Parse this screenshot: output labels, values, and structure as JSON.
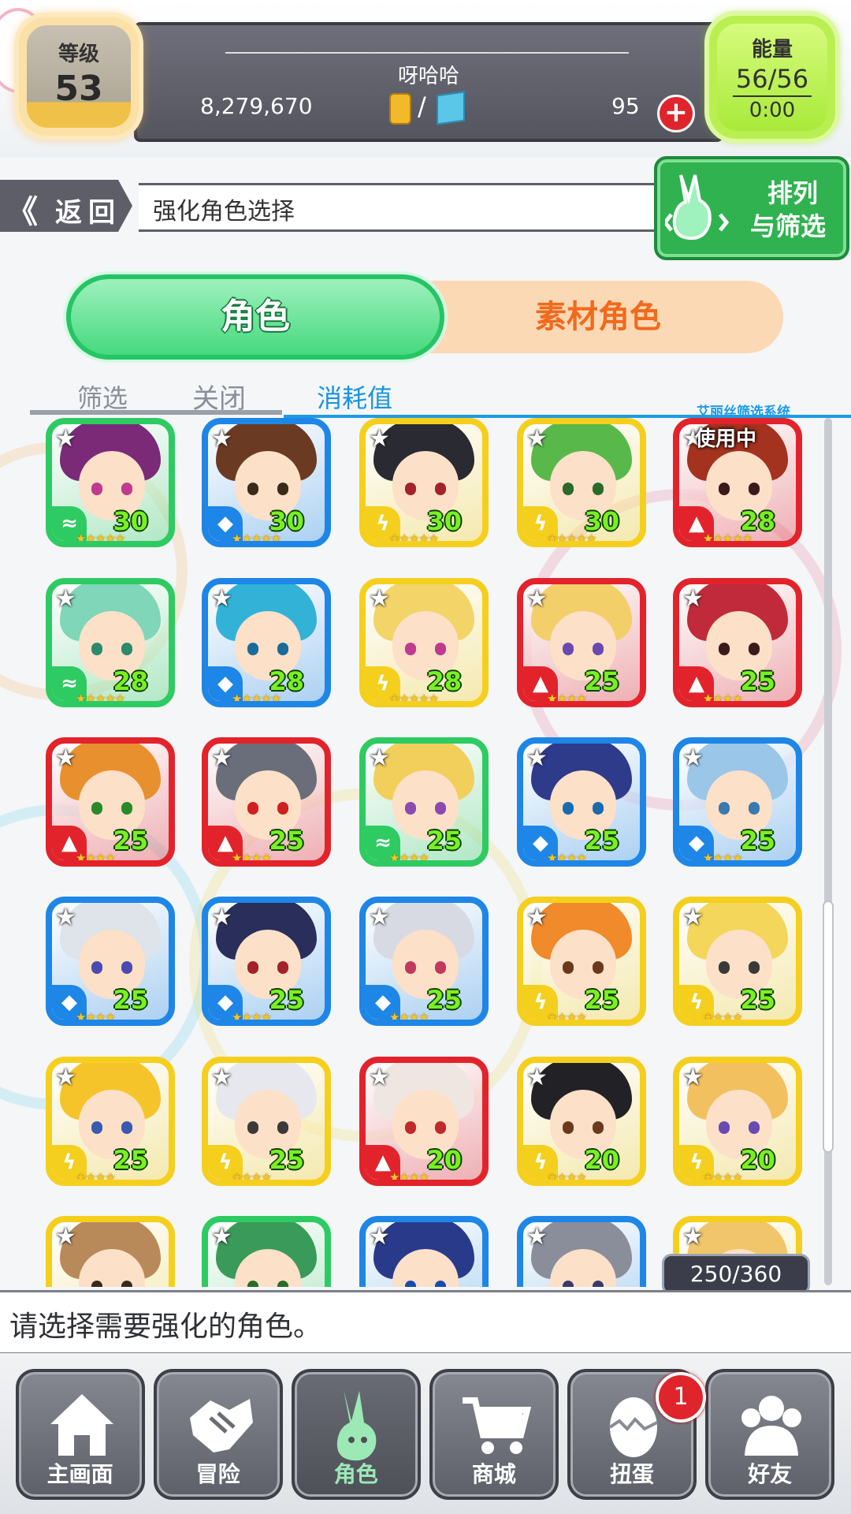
{
  "header": {
    "level_label": "等级",
    "level_value": "53",
    "player_name": "呀哈哈",
    "coins": "8,279,670",
    "currency_separator": "/",
    "gems": "95",
    "add_gems_symbol": "+",
    "energy_label": "能量",
    "energy_value": "56/56",
    "energy_timer": "0:00"
  },
  "nav": {
    "menu_symbol": "›",
    "back_chevron": "《",
    "back_label": "返回",
    "screen_title": "强化角色选择",
    "sort_line1": "排列",
    "sort_line2": "与筛选"
  },
  "tabs": {
    "character": "角色",
    "material": "素材角色"
  },
  "filter": {
    "label": "筛选",
    "status": "关闭",
    "sort_basis": "消耗值",
    "system_label": "艾丽丝筛选系统"
  },
  "colors": {
    "wood": "#2ecb62",
    "water": "#1e86e6",
    "thunder": "#f5cf1d",
    "fire": "#e3232b"
  },
  "grid": {
    "in_use_label": "使用中",
    "count": "250/360",
    "cards": [
      {
        "element": "wood",
        "level": "30",
        "stars": "★★★★★",
        "hair": "#7b2a78",
        "eye": "#c03a8f"
      },
      {
        "element": "water",
        "level": "30",
        "stars": "★★★★★",
        "hair": "#6b3a22",
        "eye": "#3a2a1a"
      },
      {
        "element": "thunder",
        "level": "30",
        "stars": "★★★★★",
        "hair": "#2a2a33",
        "eye": "#a3232a"
      },
      {
        "element": "thunder",
        "level": "30",
        "stars": "★★★★★",
        "hair": "#59b84a",
        "eye": "#2a6a2a"
      },
      {
        "element": "fire",
        "level": "28",
        "stars": "★★★★★",
        "hair": "#a3321e",
        "eye": "#3a1a1a",
        "in_use": true
      },
      {
        "element": "wood",
        "level": "28",
        "stars": "★★★★★",
        "hair": "#7fd6b8",
        "eye": "#2c8a6c"
      },
      {
        "element": "water",
        "level": "28",
        "stars": "★★★★★",
        "hair": "#33b2d8",
        "eye": "#1a6a9a"
      },
      {
        "element": "thunder",
        "level": "28",
        "stars": "★★★★★",
        "hair": "#f2d469",
        "eye": "#c03a8f"
      },
      {
        "element": "fire",
        "level": "25",
        "stars": "★★★★",
        "hair": "#f3cf6a",
        "eye": "#6a4ab0"
      },
      {
        "element": "fire",
        "level": "25",
        "stars": "★★★★",
        "hair": "#c02a3a",
        "eye": "#3a1a1a"
      },
      {
        "element": "fire",
        "level": "25",
        "stars": "★★★★",
        "hair": "#e8902e",
        "eye": "#2a8a2a"
      },
      {
        "element": "fire",
        "level": "25",
        "stars": "★★★★",
        "hair": "#6a6e7a",
        "eye": "#d02020"
      },
      {
        "element": "wood",
        "level": "25",
        "stars": "★★★★",
        "hair": "#f1cf5a",
        "eye": "#8a4ab0"
      },
      {
        "element": "water",
        "level": "25",
        "stars": "★★★★",
        "hair": "#2e3a8a",
        "eye": "#1a6ab0"
      },
      {
        "element": "water",
        "level": "25",
        "stars": "★★★★",
        "hair": "#9ac6e8",
        "eye": "#3a7ab0"
      },
      {
        "element": "water",
        "level": "25",
        "stars": "★★★★",
        "hair": "#dfe3ea",
        "eye": "#4a4ab0"
      },
      {
        "element": "water",
        "level": "25",
        "stars": "★★★★",
        "hair": "#2a2e5a",
        "eye": "#a3232a"
      },
      {
        "element": "water",
        "level": "25",
        "stars": "★★★★",
        "hair": "#d8dae3",
        "eye": "#c03a5f"
      },
      {
        "element": "thunder",
        "level": "25",
        "stars": "★★★★",
        "hair": "#f08a2a",
        "eye": "#6a3a1a"
      },
      {
        "element": "thunder",
        "level": "25",
        "stars": "★★★★",
        "hair": "#f3d65a",
        "eye": "#3a3a3a"
      },
      {
        "element": "thunder",
        "level": "25",
        "stars": "★★★★",
        "hair": "#f5c42a",
        "eye": "#3a5ab0"
      },
      {
        "element": "thunder",
        "level": "25",
        "stars": "★★★★",
        "hair": "#e6e8ee",
        "eye": "#3a3a3a"
      },
      {
        "element": "fire",
        "level": "20",
        "stars": "★★★★",
        "hair": "#efe6e2",
        "eye": "#c02a2a"
      },
      {
        "element": "thunder",
        "level": "20",
        "stars": "★★★★",
        "hair": "#222226",
        "eye": "#6a3a1a"
      },
      {
        "element": "thunder",
        "level": "20",
        "stars": "★★★★",
        "hair": "#f3c060",
        "eye": "#6a4ab0"
      },
      {
        "element": "thunder",
        "level": "",
        "stars": "",
        "hair": "#b88a5a",
        "eye": "#3a2a1a"
      },
      {
        "element": "wood",
        "level": "",
        "stars": "",
        "hair": "#3a9a5a",
        "eye": "#2a6a2a"
      },
      {
        "element": "water",
        "level": "",
        "stars": "",
        "hair": "#2a3a8a",
        "eye": "#1a4ab0"
      },
      {
        "element": "water",
        "level": "",
        "stars": "",
        "hair": "#8a8e9a",
        "eye": "#3a3a6a"
      },
      {
        "element": "thunder",
        "level": "",
        "stars": "",
        "hair": "#f1c66a",
        "eye": "#6a3a1a"
      }
    ]
  },
  "instruction": "请选择需要强化的角色。",
  "bottom_nav": {
    "gacha_badge": "1",
    "items": [
      {
        "label": "主画面",
        "icon": "home-icon"
      },
      {
        "label": "冒险",
        "icon": "handshake-icon"
      },
      {
        "label": "角色",
        "icon": "bunny-icon",
        "active": true
      },
      {
        "label": "商城",
        "icon": "cart-icon"
      },
      {
        "label": "扭蛋",
        "icon": "egg-icon"
      },
      {
        "label": "好友",
        "icon": "friends-icon"
      }
    ]
  }
}
